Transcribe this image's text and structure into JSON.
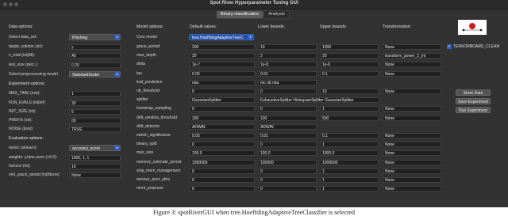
{
  "window": {
    "title": "Spot River Hyperparameter Tuning GUI"
  },
  "tabs": [
    {
      "label": "Binary classification"
    },
    {
      "label": "Analysis"
    }
  ],
  "headers": {
    "data_options": "Data options:",
    "model_options": "Model options:",
    "default_values": "Default values:",
    "lower_bounds": "Lower bounds:",
    "upper_bounds": "Upper bounds:",
    "transformation": "Transformation:",
    "experiment_options": "Experiment options:",
    "evaluation_options": "Evaluation options:"
  },
  "data_options": {
    "select_data_set": {
      "label": "Select data_set:",
      "value": "Phishing"
    },
    "target_column": {
      "label": "target_column (str):",
      "value": "y"
    },
    "n_total": {
      "label": "n_total (int|All):",
      "value": "All"
    },
    "test_size": {
      "label": "test_size (perc.):",
      "value": "0.20"
    },
    "preprocessing": {
      "label": "Select preprocessing model",
      "value": "StandardScaler"
    }
  },
  "experiment_options": {
    "max_time": {
      "label": "MAX_TIME (min):",
      "value": "1"
    },
    "fun_evals": {
      "label": "FUN_EVALS (int|inf):",
      "value": "30"
    },
    "init_size": {
      "label": "INIT_SIZE (int):",
      "value": "5"
    },
    "prefix": {
      "label": "PREFIX (str):",
      "value": "00"
    },
    "noise": {
      "label": "NOISE (bool):",
      "value": "TRUE"
    }
  },
  "evaluation_options": {
    "metric": {
      "label": "metric (sklearn):",
      "value": "accuracy_score"
    },
    "weights": {
      "label": "weights: y,time,mem (>0.0):",
      "value": "1000, 1, 1"
    },
    "horizon": {
      "label": "horizon (int):",
      "value": "10"
    },
    "oml_grace_period": {
      "label": "oml_grace_period (int|None):",
      "value": "None"
    }
  },
  "core_model": {
    "label": "Core model",
    "value": "tree.HoeffdingAdaptiveTreeC"
  },
  "params": [
    {
      "name": "grace_period",
      "default": "200",
      "lower": "10",
      "upper": "1000",
      "transform": "None"
    },
    {
      "name": "max_depth",
      "default": "20",
      "lower": "2",
      "upper": "20",
      "transform": "transform_power_2_int"
    },
    {
      "name": "delta",
      "default": "1e-7",
      "lower": "1e-8",
      "upper": "1e-6",
      "transform": "None"
    },
    {
      "name": "tau",
      "default": "0.05",
      "lower": "0.01",
      "upper": "0.1",
      "transform": "None"
    },
    {
      "name": "leaf_prediction",
      "default": "nba",
      "lower": "mc nb nba",
      "upper": "",
      "transform": ""
    },
    {
      "name": "nb_threshold",
      "default": "0",
      "lower": "0",
      "upper": "10",
      "transform": "None"
    },
    {
      "name": "splitter",
      "default": "GaussianSplitter",
      "lower": "ExhaustiveSplitter HistogramSplitter GaussianSplitter",
      "upper": "",
      "transform": ""
    },
    {
      "name": "bootstrap_sampling",
      "default": "0",
      "lower": "0",
      "upper": "1",
      "transform": "None"
    },
    {
      "name": "drift_window_threshold",
      "default": "300",
      "lower": "100",
      "upper": "500",
      "transform": "None"
    },
    {
      "name": "drift_detector",
      "default": "ADWIN",
      "lower": "ADWIN",
      "upper": "",
      "transform": ""
    },
    {
      "name": "switch_significance",
      "default": "0.05",
      "lower": "0.01",
      "upper": "0.1",
      "transform": "None"
    },
    {
      "name": "binary_split",
      "default": "0",
      "lower": "0",
      "upper": "1",
      "transform": "None"
    },
    {
      "name": "max_size",
      "default": "100.0",
      "lower": "100.0",
      "upper": "1000.0",
      "transform": "None"
    },
    {
      "name": "memory_estimate_period",
      "default": "1000000",
      "lower": "100000",
      "upper": "1000000",
      "transform": "None"
    },
    {
      "name": "stop_mem_management",
      "default": "0",
      "lower": "0",
      "upper": "1",
      "transform": "None"
    },
    {
      "name": "remove_poor_attrs",
      "default": "0",
      "lower": "0",
      "upper": "1",
      "transform": "None"
    },
    {
      "name": "merit_preprune",
      "default": "0",
      "lower": "0",
      "upper": "1",
      "transform": "None"
    }
  ],
  "tensorboard": {
    "label": "TENSORBOARD_CLEAN",
    "checked": true
  },
  "buttons": {
    "show_data": "Show Data",
    "save_experiment": "Save Experiment",
    "run_experiment": "Run Experiment"
  },
  "caption": "Figure 3: spotRiverGUI when tree.HoeffdingAdaptiveTreeClassifier is selected",
  "colors": {
    "window_bg": "#323232",
    "accent": "#2e62c9",
    "input_bg": "#202020"
  }
}
